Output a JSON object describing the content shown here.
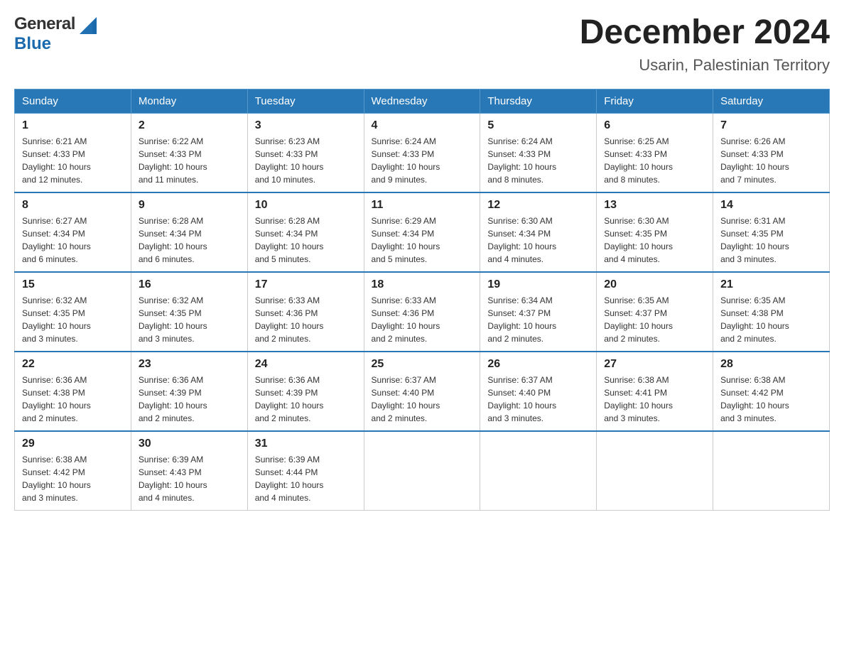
{
  "header": {
    "title": "December 2024",
    "subtitle": "Usarin, Palestinian Territory",
    "logo_general": "General",
    "logo_blue": "Blue"
  },
  "columns": [
    "Sunday",
    "Monday",
    "Tuesday",
    "Wednesday",
    "Thursday",
    "Friday",
    "Saturday"
  ],
  "weeks": [
    [
      {
        "day": "1",
        "sunrise": "6:21 AM",
        "sunset": "4:33 PM",
        "daylight": "10 hours and 12 minutes."
      },
      {
        "day": "2",
        "sunrise": "6:22 AM",
        "sunset": "4:33 PM",
        "daylight": "10 hours and 11 minutes."
      },
      {
        "day": "3",
        "sunrise": "6:23 AM",
        "sunset": "4:33 PM",
        "daylight": "10 hours and 10 minutes."
      },
      {
        "day": "4",
        "sunrise": "6:24 AM",
        "sunset": "4:33 PM",
        "daylight": "10 hours and 9 minutes."
      },
      {
        "day": "5",
        "sunrise": "6:24 AM",
        "sunset": "4:33 PM",
        "daylight": "10 hours and 8 minutes."
      },
      {
        "day": "6",
        "sunrise": "6:25 AM",
        "sunset": "4:33 PM",
        "daylight": "10 hours and 8 minutes."
      },
      {
        "day": "7",
        "sunrise": "6:26 AM",
        "sunset": "4:33 PM",
        "daylight": "10 hours and 7 minutes."
      }
    ],
    [
      {
        "day": "8",
        "sunrise": "6:27 AM",
        "sunset": "4:34 PM",
        "daylight": "10 hours and 6 minutes."
      },
      {
        "day": "9",
        "sunrise": "6:28 AM",
        "sunset": "4:34 PM",
        "daylight": "10 hours and 6 minutes."
      },
      {
        "day": "10",
        "sunrise": "6:28 AM",
        "sunset": "4:34 PM",
        "daylight": "10 hours and 5 minutes."
      },
      {
        "day": "11",
        "sunrise": "6:29 AM",
        "sunset": "4:34 PM",
        "daylight": "10 hours and 5 minutes."
      },
      {
        "day": "12",
        "sunrise": "6:30 AM",
        "sunset": "4:34 PM",
        "daylight": "10 hours and 4 minutes."
      },
      {
        "day": "13",
        "sunrise": "6:30 AM",
        "sunset": "4:35 PM",
        "daylight": "10 hours and 4 minutes."
      },
      {
        "day": "14",
        "sunrise": "6:31 AM",
        "sunset": "4:35 PM",
        "daylight": "10 hours and 3 minutes."
      }
    ],
    [
      {
        "day": "15",
        "sunrise": "6:32 AM",
        "sunset": "4:35 PM",
        "daylight": "10 hours and 3 minutes."
      },
      {
        "day": "16",
        "sunrise": "6:32 AM",
        "sunset": "4:35 PM",
        "daylight": "10 hours and 3 minutes."
      },
      {
        "day": "17",
        "sunrise": "6:33 AM",
        "sunset": "4:36 PM",
        "daylight": "10 hours and 2 minutes."
      },
      {
        "day": "18",
        "sunrise": "6:33 AM",
        "sunset": "4:36 PM",
        "daylight": "10 hours and 2 minutes."
      },
      {
        "day": "19",
        "sunrise": "6:34 AM",
        "sunset": "4:37 PM",
        "daylight": "10 hours and 2 minutes."
      },
      {
        "day": "20",
        "sunrise": "6:35 AM",
        "sunset": "4:37 PM",
        "daylight": "10 hours and 2 minutes."
      },
      {
        "day": "21",
        "sunrise": "6:35 AM",
        "sunset": "4:38 PM",
        "daylight": "10 hours and 2 minutes."
      }
    ],
    [
      {
        "day": "22",
        "sunrise": "6:36 AM",
        "sunset": "4:38 PM",
        "daylight": "10 hours and 2 minutes."
      },
      {
        "day": "23",
        "sunrise": "6:36 AM",
        "sunset": "4:39 PM",
        "daylight": "10 hours and 2 minutes."
      },
      {
        "day": "24",
        "sunrise": "6:36 AM",
        "sunset": "4:39 PM",
        "daylight": "10 hours and 2 minutes."
      },
      {
        "day": "25",
        "sunrise": "6:37 AM",
        "sunset": "4:40 PM",
        "daylight": "10 hours and 2 minutes."
      },
      {
        "day": "26",
        "sunrise": "6:37 AM",
        "sunset": "4:40 PM",
        "daylight": "10 hours and 3 minutes."
      },
      {
        "day": "27",
        "sunrise": "6:38 AM",
        "sunset": "4:41 PM",
        "daylight": "10 hours and 3 minutes."
      },
      {
        "day": "28",
        "sunrise": "6:38 AM",
        "sunset": "4:42 PM",
        "daylight": "10 hours and 3 minutes."
      }
    ],
    [
      {
        "day": "29",
        "sunrise": "6:38 AM",
        "sunset": "4:42 PM",
        "daylight": "10 hours and 3 minutes."
      },
      {
        "day": "30",
        "sunrise": "6:39 AM",
        "sunset": "4:43 PM",
        "daylight": "10 hours and 4 minutes."
      },
      {
        "day": "31",
        "sunrise": "6:39 AM",
        "sunset": "4:44 PM",
        "daylight": "10 hours and 4 minutes."
      },
      null,
      null,
      null,
      null
    ]
  ],
  "labels": {
    "sunrise": "Sunrise:",
    "sunset": "Sunset:",
    "daylight": "Daylight:"
  }
}
